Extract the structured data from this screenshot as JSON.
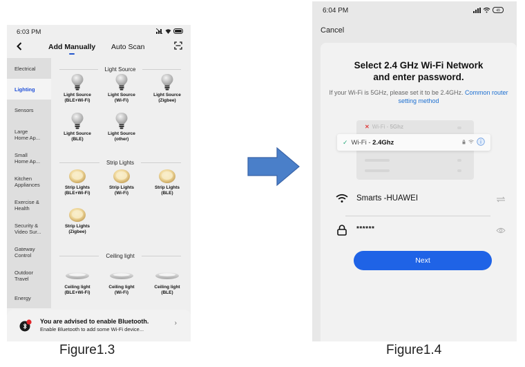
{
  "figure13": {
    "caption": "Figure1.3",
    "status": {
      "time": "6:03 PM",
      "battery": "89"
    },
    "header": {
      "back_icon": "chevron-left-icon",
      "tab_manual": "Add Manually",
      "tab_auto": "Auto Scan",
      "scan_icon": "scan-icon",
      "active_tab": "Add Manually"
    },
    "sidebar": [
      {
        "label": "Electrical",
        "active": false
      },
      {
        "label": "Lighting",
        "active": true
      },
      {
        "label": "Sensors",
        "active": false
      },
      {
        "label": "Large\nHome Ap...",
        "active": false
      },
      {
        "label": "Small\nHome Ap...",
        "active": false
      },
      {
        "label": "Kitchen\nAppliances",
        "active": false
      },
      {
        "label": "Exercise &\nHealth",
        "active": false
      },
      {
        "label": "Security &\nVideo Sur...",
        "active": false
      },
      {
        "label": "Gateway\nControl",
        "active": false
      },
      {
        "label": "Outdoor\nTravel",
        "active": false
      },
      {
        "label": "Energy",
        "active": false
      }
    ],
    "sections": [
      {
        "title": "Light Source",
        "icon": "bulb-icon",
        "devices": [
          {
            "name": "Light Source",
            "proto": "(BLE+Wi-Fi)"
          },
          {
            "name": "Light Source",
            "proto": "(Wi-Fi)"
          },
          {
            "name": "Light Source",
            "proto": "(Zigbee)"
          },
          {
            "name": "Light Source",
            "proto": "(BLE)"
          },
          {
            "name": "Light Source",
            "proto": "(other)"
          }
        ]
      },
      {
        "title": "Strip Lights",
        "icon": "strip-light-icon",
        "devices": [
          {
            "name": "Strip Lights",
            "proto": "(BLE+Wi-Fi)"
          },
          {
            "name": "Strip Lights",
            "proto": "(Wi-Fi)"
          },
          {
            "name": "Strip Lights",
            "proto": "(BLE)"
          },
          {
            "name": "Strip Lights",
            "proto": "(Zigbee)"
          }
        ]
      },
      {
        "title": "Ceiling light",
        "icon": "ceiling-light-icon",
        "devices": [
          {
            "name": "Ceiling light",
            "proto": "(BLE+Wi-Fi)"
          },
          {
            "name": "Ceiling light",
            "proto": "(Wi-Fi)"
          },
          {
            "name": "Ceiling light",
            "proto": "(BLE)"
          }
        ]
      }
    ],
    "banner": {
      "title": "You are advised to enable Bluetooth.",
      "subtitle": "Enable Bluetooth to add some Wi-Fi device...",
      "chevron": "›"
    }
  },
  "arrow": {
    "icon": "right-arrow-icon",
    "color": "#4a7fc9"
  },
  "figure14": {
    "caption": "Figure1.4",
    "status": {
      "time": "6:04 PM",
      "battery": "49"
    },
    "cancel": "Cancel",
    "title_line1": "Select 2.4 GHz Wi-Fi Network",
    "title_line2": "and enter password.",
    "subtitle": "If your Wi-Fi is 5GHz, please set it to be 2.4GHz.",
    "link": "Common router setting method",
    "illustration": {
      "bad": {
        "prefix": "Wi-Fi - ",
        "band": "5Ghz",
        "mark": "✕"
      },
      "good": {
        "prefix": "Wi-Fi - ",
        "band": "2.4Ghz",
        "mark": "✓"
      }
    },
    "ssid": "Smarts -HUAWEI",
    "password_masked": "******",
    "next": "Next",
    "colors": {
      "accent": "#1f63e6",
      "link": "#1c6fd1",
      "ok": "#28a87a",
      "bad": "#e04040"
    }
  }
}
